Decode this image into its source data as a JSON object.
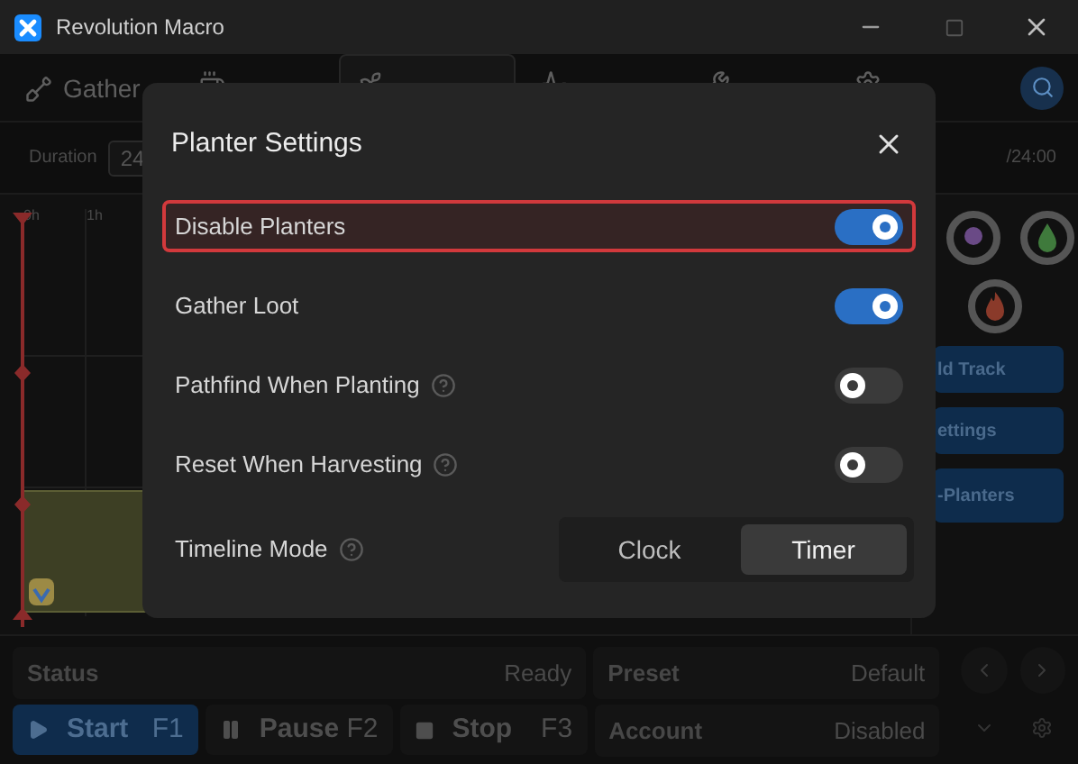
{
  "window": {
    "title": "Revolution Macro"
  },
  "tabs": [
    {
      "label": "Gather",
      "selected": false
    },
    {
      "selected": false
    },
    {
      "selected": true
    },
    {
      "selected": false
    },
    {
      "selected": false
    },
    {
      "selected": false
    }
  ],
  "duration": {
    "label": "Duration",
    "value": "24"
  },
  "time_readout": "/24:00",
  "timeline": {
    "ticks": [
      "0h",
      "1h"
    ]
  },
  "side_buttons": [
    "ld Track",
    "ettings",
    "-Planters"
  ],
  "dialog": {
    "title": "Planter Settings",
    "settings": [
      {
        "label": "Disable Planters",
        "on": true,
        "highlighted": true,
        "help": false
      },
      {
        "label": "Gather Loot",
        "on": true,
        "highlighted": false,
        "help": false
      },
      {
        "label": "Pathfind When Planting",
        "on": false,
        "highlighted": false,
        "help": true
      },
      {
        "label": "Reset When Harvesting",
        "on": false,
        "highlighted": false,
        "help": true
      }
    ],
    "timeline_mode": {
      "label": "Timeline Mode",
      "help": true,
      "options": [
        {
          "label": "Clock",
          "selected": false
        },
        {
          "label": "Timer",
          "selected": true
        }
      ]
    }
  },
  "status": {
    "label": "Status",
    "value": "Ready"
  },
  "preset": {
    "label": "Preset",
    "value": "Default"
  },
  "account": {
    "label": "Account",
    "value": "Disabled"
  },
  "controls": [
    {
      "label": "Start",
      "key": "F1",
      "kind": "start"
    },
    {
      "label": "Pause",
      "key": "F2",
      "kind": "pause"
    },
    {
      "label": "Stop",
      "key": "F3",
      "kind": "stop"
    }
  ]
}
